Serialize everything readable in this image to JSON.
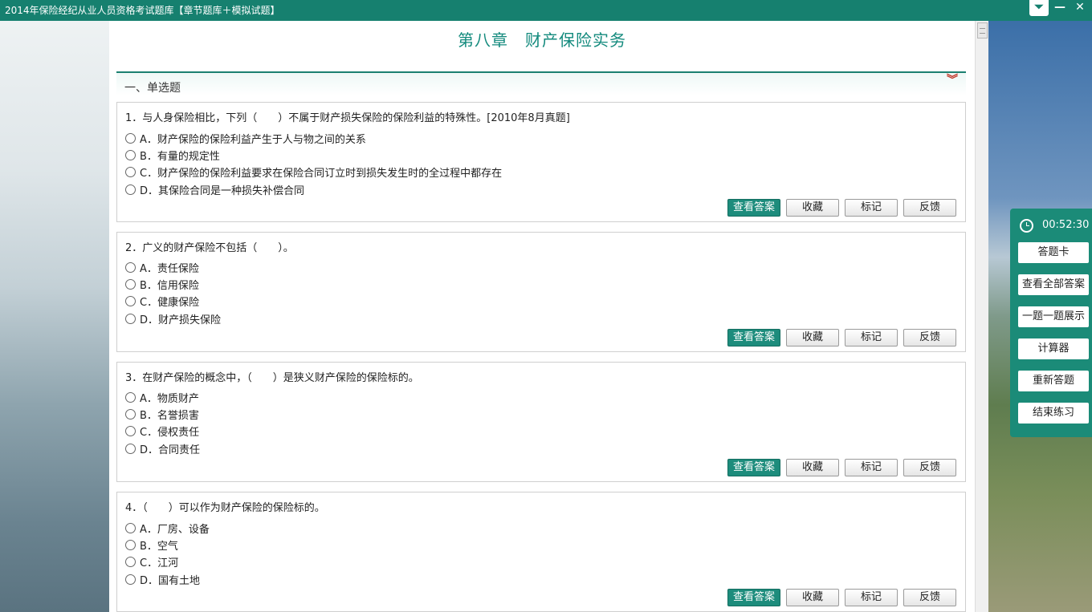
{
  "window": {
    "title": "2014年保险经纪从业人员资格考试题库【章节题库＋模拟试题】",
    "dropdown_glyph": "⏷",
    "minimize_glyph": "—",
    "close_glyph": "✕"
  },
  "chapter": {
    "title": "第八章　财产保险实务"
  },
  "section": {
    "title": "一、单选题",
    "collapse_glyph": "︾"
  },
  "buttons": {
    "view_answer": "查看答案",
    "favorite": "收藏",
    "mark": "标记",
    "feedback": "反馈"
  },
  "questions": [
    {
      "text": "1．与人身保险相比，下列（　　）不属于财产损失保险的保险利益的特殊性。[2010年8月真题]",
      "options": [
        "A．财产保险的保险利益产生于人与物之间的关系",
        "B．有量的规定性",
        "C．财产保险的保险利益要求在保险合同订立时到损失发生时的全过程中都存在",
        "D．其保险合同是一种损失补偿合同"
      ]
    },
    {
      "text": "2．广义的财产保险不包括（　　）。",
      "options": [
        "A．责任保险",
        "B．信用保险",
        "C．健康保险",
        "D．财产损失保险"
      ]
    },
    {
      "text": "3．在财产保险的概念中，（　　）是狭义财产保险的保险标的。",
      "options": [
        "A．物质财产",
        "B．名誉损害",
        "C．侵权责任",
        "D．合同责任"
      ]
    },
    {
      "text": "4．（　　）可以作为财产保险的保险标的。",
      "options": [
        "A．厂房、设备",
        "B．空气",
        "C．江河",
        "D．国有土地"
      ]
    }
  ],
  "sidepanel": {
    "timer": "00:52:30",
    "items": [
      "答题卡",
      "查看全部答案",
      "一题一题展示",
      "计算器",
      "重新答题",
      "结束练习"
    ]
  }
}
